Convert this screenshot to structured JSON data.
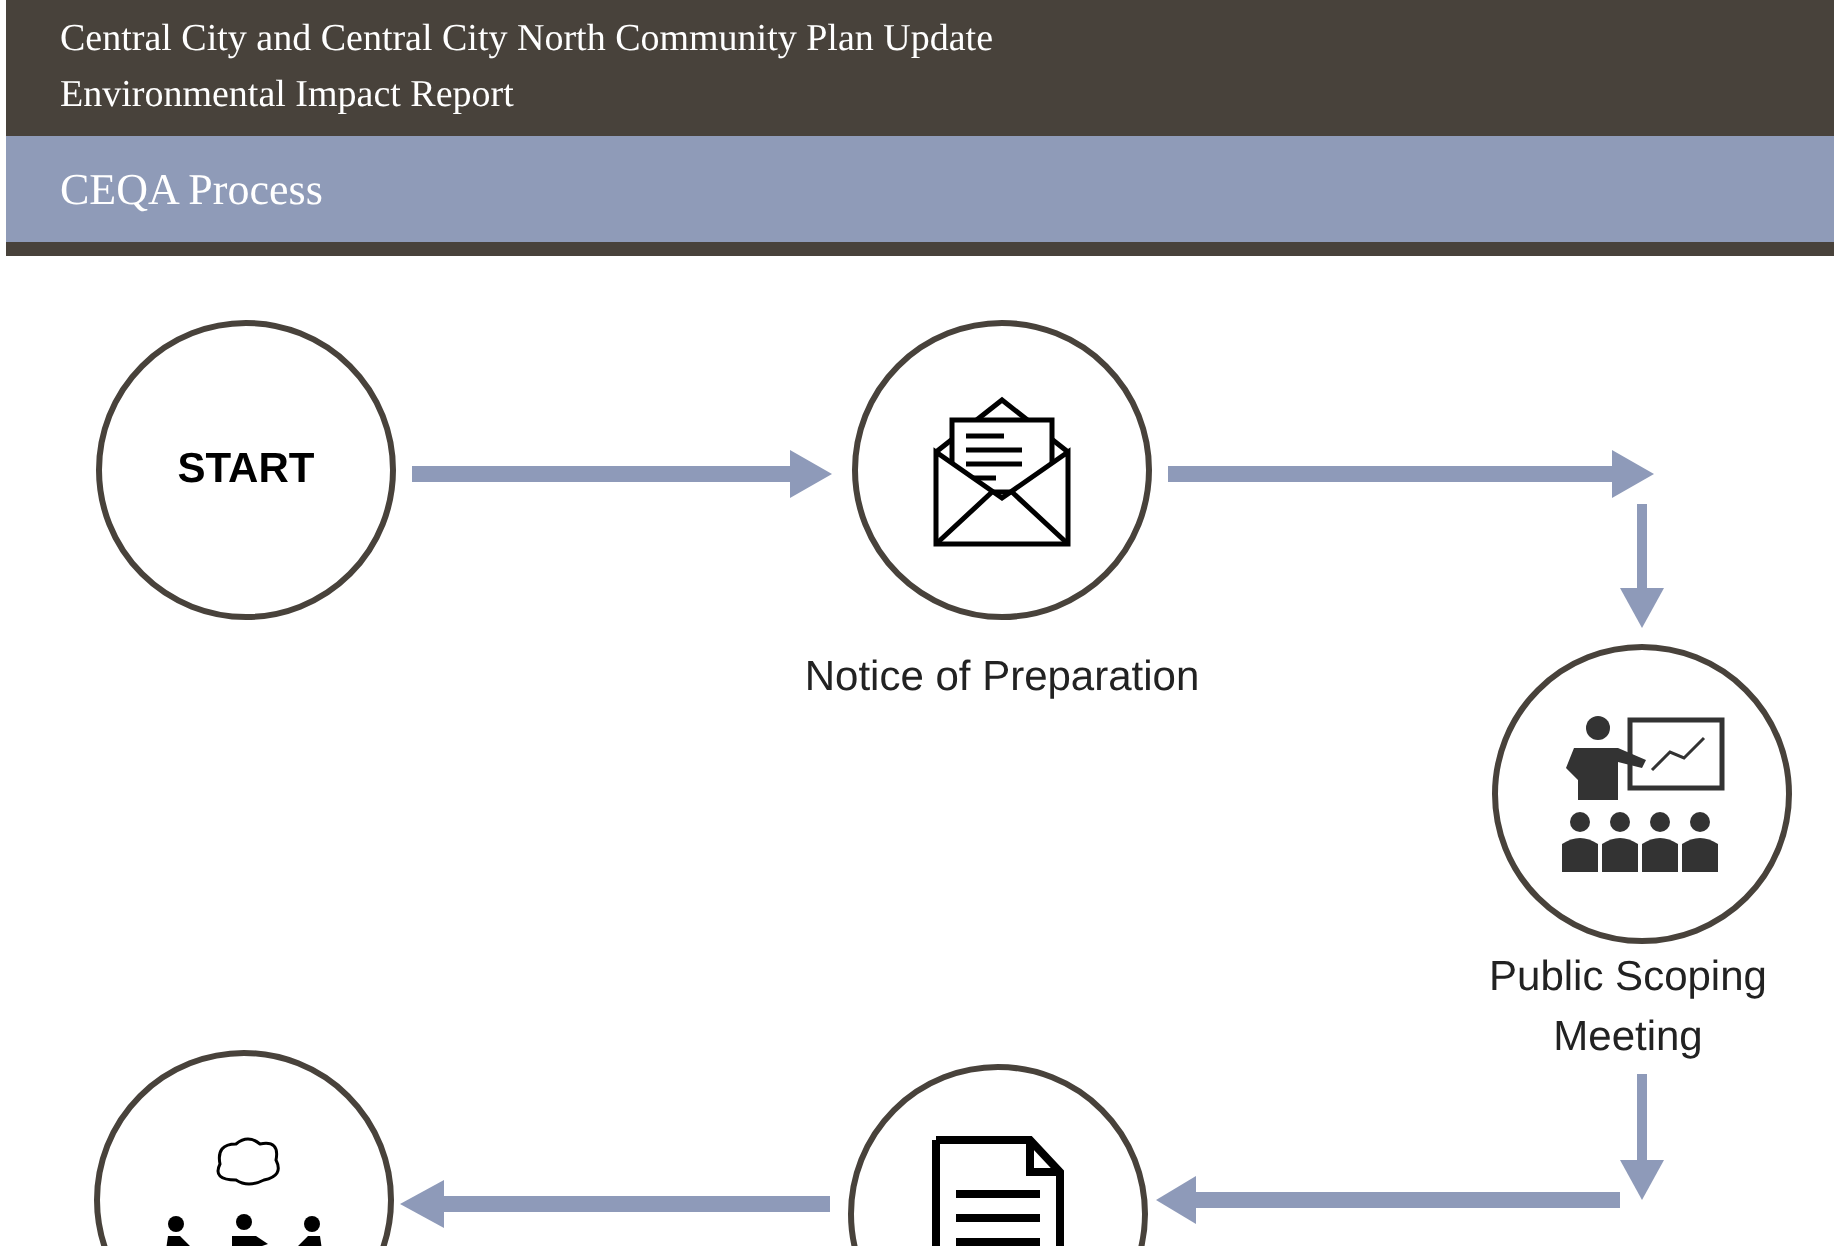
{
  "header": {
    "title_lines": [
      "Central City and Central City North Community Plan Update",
      "Environmental Impact Report"
    ]
  },
  "section": {
    "title": "CEQA Process"
  },
  "steps": [
    {
      "kind": "text",
      "text": "START"
    },
    {
      "kind": "envelope",
      "label": "Notice of Preparation"
    },
    {
      "kind": "presentation",
      "label": "Public Scoping Meeting"
    },
    {
      "kind": "document"
    },
    {
      "kind": "meeting"
    }
  ]
}
